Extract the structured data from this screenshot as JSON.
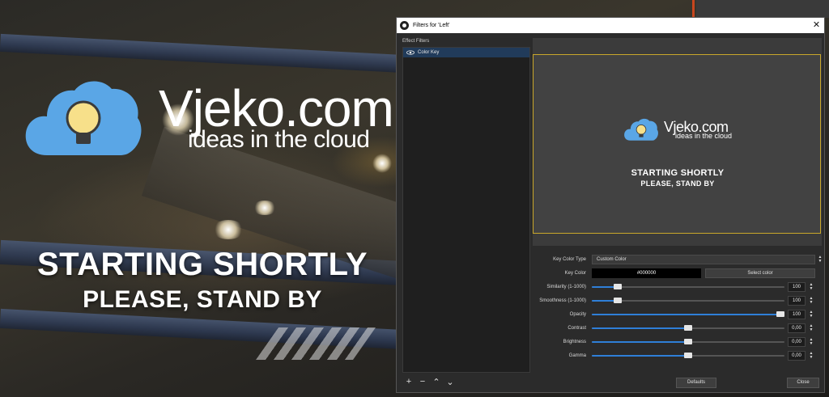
{
  "background": {
    "brand": "Vjeko.com",
    "tagline": "ideas in the cloud",
    "headline": "STARTING SHORTLY",
    "subheadline": "PLEASE, STAND BY"
  },
  "dialog": {
    "title": "Filters for 'Left'",
    "effect_filters_label": "Effect Filters",
    "filters": [
      {
        "name": "Color Key",
        "visible": true,
        "selected": true
      }
    ],
    "list_tools": {
      "add": "+",
      "remove": "−",
      "up": "⌃",
      "down": "⌄"
    },
    "preview": {
      "brand": "Vjeko.com",
      "tagline": "ideas in the cloud",
      "headline": "STARTING SHORTLY",
      "subheadline": "PLEASE, STAND BY"
    },
    "properties": {
      "key_color_type": {
        "label": "Key Color Type",
        "value": "Custom Color"
      },
      "key_color": {
        "label": "Key Color",
        "value": "#000000",
        "button": "Select color",
        "swatch": "#000000"
      },
      "similarity": {
        "label": "Similarity (1-1000)",
        "value": "100",
        "fraction": 0.12
      },
      "smoothness": {
        "label": "Smoothness (1-1000)",
        "value": "100",
        "fraction": 0.12
      },
      "opacity": {
        "label": "Opacity",
        "value": "100",
        "fraction": 1.0
      },
      "contrast": {
        "label": "Contrast",
        "value": "0,00",
        "fraction": 0.5
      },
      "brightness": {
        "label": "Brightness",
        "value": "0,00",
        "fraction": 0.5
      },
      "gamma": {
        "label": "Gamma",
        "value": "0,00",
        "fraction": 0.5
      }
    },
    "defaults_button": "Defaults",
    "close_button": "Close"
  },
  "colors": {
    "accent": "#2f7fd8",
    "selection": "#213b5a",
    "preview_border": "#c9a72a",
    "cloud": "#5aa6e6",
    "bulb": "#f7e08a"
  }
}
